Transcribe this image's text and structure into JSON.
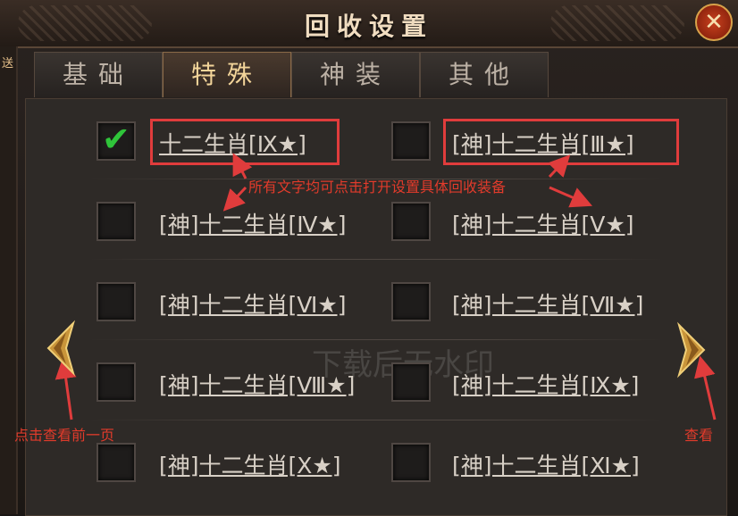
{
  "window": {
    "title": "回收设置",
    "close_label": "✕"
  },
  "left_strip_text": "送",
  "tabs": [
    {
      "label": "基础",
      "active": false
    },
    {
      "label": "特殊",
      "active": true
    },
    {
      "label": "神装",
      "active": false
    },
    {
      "label": "其他",
      "active": false
    }
  ],
  "items": [
    {
      "label": "十二生肖[Ⅸ★]",
      "checked": true
    },
    {
      "label": "[神]十二生肖[Ⅲ★]",
      "checked": false
    },
    {
      "label": "[神]十二生肖[Ⅳ★]",
      "checked": false
    },
    {
      "label": "[神]十二生肖[Ⅴ★]",
      "checked": false
    },
    {
      "label": "[神]十二生肖[Ⅵ★]",
      "checked": false
    },
    {
      "label": "[神]十二生肖[Ⅶ★]",
      "checked": false
    },
    {
      "label": "[神]十二生肖[Ⅷ★]",
      "checked": false
    },
    {
      "label": "[神]十二生肖[Ⅸ★]",
      "checked": false
    },
    {
      "label": "[神]十二生肖[Ⅹ★]",
      "checked": false
    },
    {
      "label": "[神]十二生肖[Ⅺ★]",
      "checked": false
    }
  ],
  "annotations": {
    "center_note": "所有文字均可点击打开设置具体回收装备",
    "prev_note": "点击查看前一页",
    "next_note": "查看"
  },
  "watermark": "下载后无水印",
  "colors": {
    "accent": "#e03c3c",
    "tab_active_text": "#f3d59a",
    "check": "#2fc43a"
  },
  "icons": {
    "prev": "gold-arrow-left-icon",
    "next": "gold-arrow-right-icon",
    "close": "close-icon",
    "check": "checkmark-icon"
  }
}
